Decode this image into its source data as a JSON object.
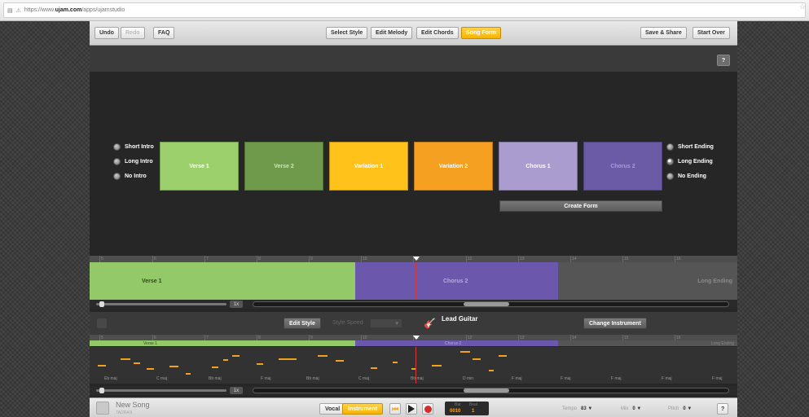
{
  "browser": {
    "url_prefix": "https://www.",
    "url_host": "ujam.com",
    "url_path": "/apps/ujamstudio"
  },
  "toolbar": {
    "undo": "Undo",
    "redo": "Redo",
    "faq": "FAQ",
    "tabs": [
      "Select Style",
      "Edit Melody",
      "Edit Chords",
      "Song Form"
    ],
    "active_tab": "Song Form",
    "save_share": "Save & Share",
    "start_over": "Start Over"
  },
  "help": "?",
  "intro_options": [
    {
      "label": "Short Intro",
      "selected": false
    },
    {
      "label": "Long Intro",
      "selected": false
    },
    {
      "label": "No Intro",
      "selected": false
    }
  ],
  "ending_options": [
    {
      "label": "Short Ending",
      "selected": false
    },
    {
      "label": "Long Ending",
      "selected": true
    },
    {
      "label": "No Ending",
      "selected": false
    }
  ],
  "blocks": [
    {
      "label": "Verse 1",
      "color": "#9bd06d"
    },
    {
      "label": "Verse 2",
      "color": "#6f9a4c"
    },
    {
      "label": "Variation 1",
      "color": "#ffc21a"
    },
    {
      "label": "Variation 2",
      "color": "#f5a020"
    },
    {
      "label": "Chorus 1",
      "color": "#ab9ccf"
    },
    {
      "label": "Chorus 2",
      "color": "#6b5aa6"
    }
  ],
  "create_form": "Create Form",
  "ruler_bars": [
    "5",
    "6",
    "7",
    "8",
    "9",
    "10",
    "11",
    "12",
    "13",
    "14",
    "15",
    "16"
  ],
  "timeline": {
    "segments": [
      {
        "label": "Verse 1",
        "color": "#94c96a"
      },
      {
        "label": "Chorus 2",
        "color": "#6b58ad"
      },
      {
        "label": "Long Ending",
        "color": "#555555"
      }
    ],
    "zoom": "1x"
  },
  "instrument": {
    "edit_style": "Edit Style",
    "style_speed": "Style Speed",
    "name": "Lead Guitar",
    "change": "Change Instrument"
  },
  "mini_segments": [
    "Verse 1",
    "Chorus 2",
    "Long Ending"
  ],
  "chords": [
    "Eb maj",
    "C maj",
    "Bb maj",
    "F maj",
    "Bb maj",
    "C maj",
    "Bb maj",
    "D min",
    "F maj",
    "F maj",
    "F maj",
    "F maj",
    "F maj"
  ],
  "footer": {
    "song_name": "New Song",
    "song_sub": "TADRAN",
    "vocal": "Vocal",
    "instrument": "Instrument",
    "bar_label": "Bar",
    "beat_label": "Beat",
    "bar_value": "0010",
    "beat_value": "1",
    "tempo_label": "Tempo",
    "tempo_value": "83 ▼",
    "mix_label": "Mix",
    "mix_value": "0 ▼",
    "pitch_label": "Pitch",
    "pitch_value": "0 ▼",
    "help": "?"
  },
  "colors": {
    "accent": "#f5b300",
    "record": "#d42b2b",
    "playhead": "#d23a3a"
  },
  "icons": [
    "lock-icon",
    "star-icon",
    "skip-back-icon",
    "play-icon",
    "record-icon",
    "guitar-icon"
  ]
}
